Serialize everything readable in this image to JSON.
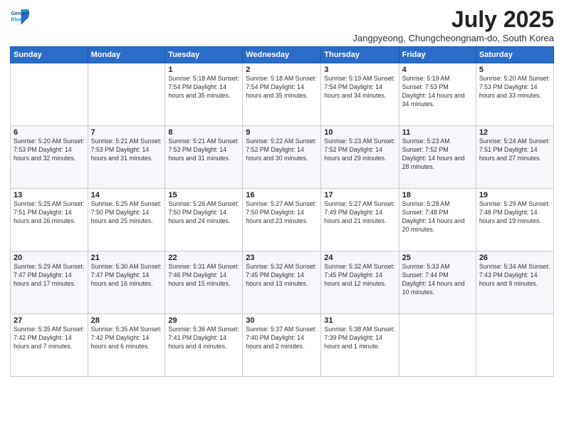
{
  "logo": {
    "line1": "General",
    "line2": "Blue"
  },
  "title": "July 2025",
  "location": "Jangpyeong, Chungcheongnam-do, South Korea",
  "weekdays": [
    "Sunday",
    "Monday",
    "Tuesday",
    "Wednesday",
    "Thursday",
    "Friday",
    "Saturday"
  ],
  "weeks": [
    [
      {
        "day": "",
        "info": ""
      },
      {
        "day": "",
        "info": ""
      },
      {
        "day": "1",
        "info": "Sunrise: 5:18 AM\nSunset: 7:54 PM\nDaylight: 14 hours and 35 minutes."
      },
      {
        "day": "2",
        "info": "Sunrise: 5:18 AM\nSunset: 7:54 PM\nDaylight: 14 hours and 35 minutes."
      },
      {
        "day": "3",
        "info": "Sunrise: 5:19 AM\nSunset: 7:54 PM\nDaylight: 14 hours and 34 minutes."
      },
      {
        "day": "4",
        "info": "Sunrise: 5:19 AM\nSunset: 7:53 PM\nDaylight: 14 hours and 34 minutes."
      },
      {
        "day": "5",
        "info": "Sunrise: 5:20 AM\nSunset: 7:53 PM\nDaylight: 14 hours and 33 minutes."
      }
    ],
    [
      {
        "day": "6",
        "info": "Sunrise: 5:20 AM\nSunset: 7:53 PM\nDaylight: 14 hours and 32 minutes."
      },
      {
        "day": "7",
        "info": "Sunrise: 5:21 AM\nSunset: 7:53 PM\nDaylight: 14 hours and 31 minutes."
      },
      {
        "day": "8",
        "info": "Sunrise: 5:21 AM\nSunset: 7:53 PM\nDaylight: 14 hours and 31 minutes."
      },
      {
        "day": "9",
        "info": "Sunrise: 5:22 AM\nSunset: 7:52 PM\nDaylight: 14 hours and 30 minutes."
      },
      {
        "day": "10",
        "info": "Sunrise: 5:23 AM\nSunset: 7:52 PM\nDaylight: 14 hours and 29 minutes."
      },
      {
        "day": "11",
        "info": "Sunrise: 5:23 AM\nSunset: 7:52 PM\nDaylight: 14 hours and 28 minutes."
      },
      {
        "day": "12",
        "info": "Sunrise: 5:24 AM\nSunset: 7:51 PM\nDaylight: 14 hours and 27 minutes."
      }
    ],
    [
      {
        "day": "13",
        "info": "Sunrise: 5:25 AM\nSunset: 7:51 PM\nDaylight: 14 hours and 26 minutes."
      },
      {
        "day": "14",
        "info": "Sunrise: 5:25 AM\nSunset: 7:50 PM\nDaylight: 14 hours and 25 minutes."
      },
      {
        "day": "15",
        "info": "Sunrise: 5:26 AM\nSunset: 7:50 PM\nDaylight: 14 hours and 24 minutes."
      },
      {
        "day": "16",
        "info": "Sunrise: 5:27 AM\nSunset: 7:50 PM\nDaylight: 14 hours and 23 minutes."
      },
      {
        "day": "17",
        "info": "Sunrise: 5:27 AM\nSunset: 7:49 PM\nDaylight: 14 hours and 21 minutes."
      },
      {
        "day": "18",
        "info": "Sunrise: 5:28 AM\nSunset: 7:48 PM\nDaylight: 14 hours and 20 minutes."
      },
      {
        "day": "19",
        "info": "Sunrise: 5:29 AM\nSunset: 7:48 PM\nDaylight: 14 hours and 19 minutes."
      }
    ],
    [
      {
        "day": "20",
        "info": "Sunrise: 5:29 AM\nSunset: 7:47 PM\nDaylight: 14 hours and 17 minutes."
      },
      {
        "day": "21",
        "info": "Sunrise: 5:30 AM\nSunset: 7:47 PM\nDaylight: 14 hours and 16 minutes."
      },
      {
        "day": "22",
        "info": "Sunrise: 5:31 AM\nSunset: 7:46 PM\nDaylight: 14 hours and 15 minutes."
      },
      {
        "day": "23",
        "info": "Sunrise: 5:32 AM\nSunset: 7:45 PM\nDaylight: 14 hours and 13 minutes."
      },
      {
        "day": "24",
        "info": "Sunrise: 5:32 AM\nSunset: 7:45 PM\nDaylight: 14 hours and 12 minutes."
      },
      {
        "day": "25",
        "info": "Sunrise: 5:33 AM\nSunset: 7:44 PM\nDaylight: 14 hours and 10 minutes."
      },
      {
        "day": "26",
        "info": "Sunrise: 5:34 AM\nSunset: 7:43 PM\nDaylight: 14 hours and 9 minutes."
      }
    ],
    [
      {
        "day": "27",
        "info": "Sunrise: 5:35 AM\nSunset: 7:42 PM\nDaylight: 14 hours and 7 minutes."
      },
      {
        "day": "28",
        "info": "Sunrise: 5:35 AM\nSunset: 7:42 PM\nDaylight: 14 hours and 6 minutes."
      },
      {
        "day": "29",
        "info": "Sunrise: 5:36 AM\nSunset: 7:41 PM\nDaylight: 14 hours and 4 minutes."
      },
      {
        "day": "30",
        "info": "Sunrise: 5:37 AM\nSunset: 7:40 PM\nDaylight: 14 hours and 2 minutes."
      },
      {
        "day": "31",
        "info": "Sunrise: 5:38 AM\nSunset: 7:39 PM\nDaylight: 14 hours and 1 minute."
      },
      {
        "day": "",
        "info": ""
      },
      {
        "day": "",
        "info": ""
      }
    ]
  ]
}
